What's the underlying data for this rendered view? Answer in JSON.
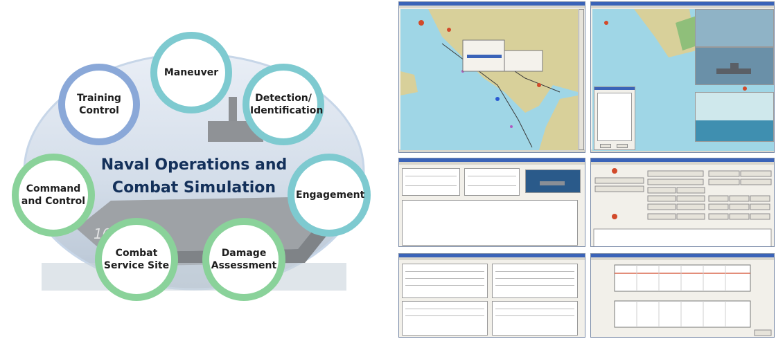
{
  "diagram": {
    "center_title_line1": "Naval Operations and",
    "center_title_line2": "Combat Simulation",
    "nodes": {
      "maneuver": "Maneuver",
      "training_control": "Training Control",
      "detection": "Detection/ Identification",
      "engagement": "Engagement",
      "damage": "Damage Assessment",
      "combat_service": "Combat Service Site",
      "command": "Command and Control"
    },
    "hull_number": "1086"
  },
  "colors": {
    "teal": "#7ecad0",
    "blue": "#8aa8d8",
    "green": "#8ad29a",
    "title": "#13305a",
    "sea": "#9fd6e6",
    "land": "#d8d09a"
  }
}
